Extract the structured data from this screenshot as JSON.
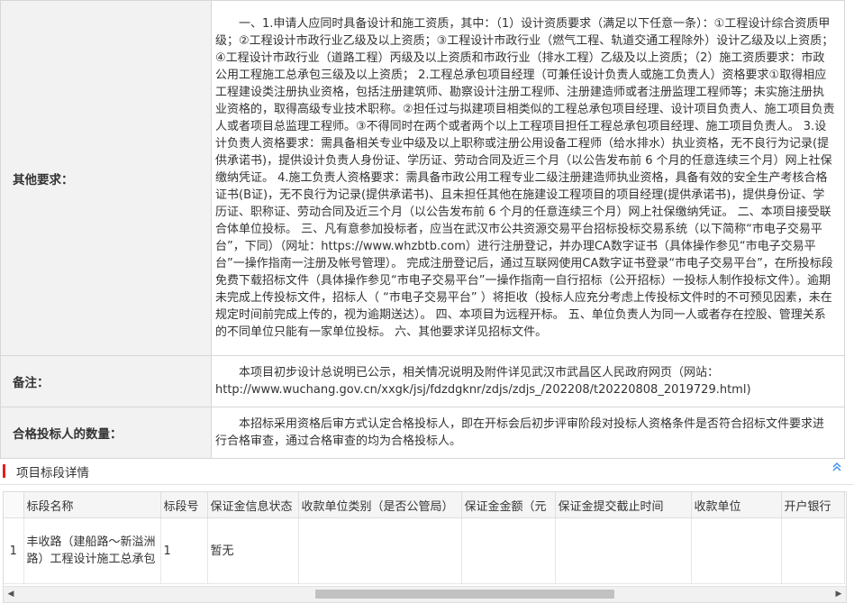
{
  "info": {
    "other_label": "其他要求：",
    "other_text": "一、1.申请人应同时具备设计和施工资质，其中：（1）设计资质要求（满足以下任意一条）：①工程设计综合资质甲级；②工程设计市政行业乙级及以上资质；③工程设计市政行业（燃气工程、轨道交通工程除外）设计乙级及以上资质；④工程设计市政行业（道路工程）丙级及以上资质和市政行业（排水工程）乙级及以上资质；（2）施工资质要求：市政公用工程施工总承包三级及以上资质； 2.工程总承包项目经理（可兼任设计负责人或施工负责人）资格要求①取得相应工程建设类注册执业资格，包括注册建筑师、勘察设计注册工程师、注册建造师或者注册监理工程师等；未实施注册执业资格的，取得高级专业技术职称。②担任过与拟建项目相类似的工程总承包项目经理、设计项目负责人、施工项目负责人或者项目总监理工程师。③不得同时在两个或者两个以上工程项目担任工程总承包项目经理、施工项目负责人。 3.设计负责人资格要求：需具备相关专业中级及以上职称或注册公用设备工程师（给水排水）执业资格，无不良行为记录(提供承诺书)，提供设计负责人身份证、学历证、劳动合同及近三个月（以公告发布前 6 个月的任意连续三个月）网上社保缴纳凭证。 4.施工负责人资格要求：需具备市政公用工程专业二级注册建造师执业资格，具备有效的安全生产考核合格证书(B证)，无不良行为记录(提供承诺书)、且未担任其他在施建设工程项目的项目经理(提供承诺书)，提供身份证、学历证、职称证、劳动合同及近三个月（以公告发布前 6 个月的任意连续三个月）网上社保缴纳凭证。 二、本项目接受联合体单位投标。 三、凡有意参加投标者，应当在武汉市公共资源交易平台招标投标交易系统（以下简称“市电子交易平台”，下同）（网址：https://www.whzbtb.com）进行注册登记，并办理CA数字证书（具体操作参见“市电子交易平台”一操作指南一注册及帐号管理）。 完成注册登记后，通过互联网使用CA数字证书登录“市电子交易平台”，在所投标段免费下载招标文件（具体操作参见“市电子交易平台”一操作指南一自行招标（公开招标）一投标人制作投标文件）。逾期未完成上传投标文件，招标人（ “市电子交易平台” ）将拒收（投标人应充分考虑上传投标文件时的不可预见因素，未在规定时间前完成上传的，视为逾期送达）。 四、本项目为远程开标。 五、单位负责人为同一人或者存在控股、管理关系的不同单位只能有一家单位投标。 六、其他要求详见招标文件。",
    "remark_label": "备注：",
    "remark_text": "本项目初步设计总说明已公示，相关情况说明及附件详见武汉市武昌区人民政府网页（网站：http://www.wuchang.gov.cn/xxgk/jsj/fdzdgknr/zdjs/zdjs_/202208/t20220808_2019729.html)",
    "qualified_label": "合格投标人的数量：",
    "qualified_text": "本招标采用资格后审方式认定合格投标人，即在开标会后初步评审阶段对投标人资格条件是否符合招标文件要求进行合格审查，通过合格审查的均为合格投标人。"
  },
  "section": {
    "title": "项目标段详情",
    "collapse_icon": "double-chevron-up-icon",
    "accent_color": "#e02020"
  },
  "grid": {
    "columns": [
      "",
      "标段名称",
      "标段号",
      "保证金信息状态",
      "收款单位类别（是否公管局）",
      "保证金金额（元",
      "保证金提交截止时间",
      "收款单位",
      "开户银行"
    ],
    "rows": [
      {
        "row_number": "1",
        "name": "丰收路（建船路～新溢洲路）工程设计施工总承包",
        "code": "1",
        "deposit_status": "暂无",
        "payee_type": "",
        "deposit_amount": "",
        "deadline": "",
        "payee": "",
        "bank": ""
      }
    ]
  }
}
